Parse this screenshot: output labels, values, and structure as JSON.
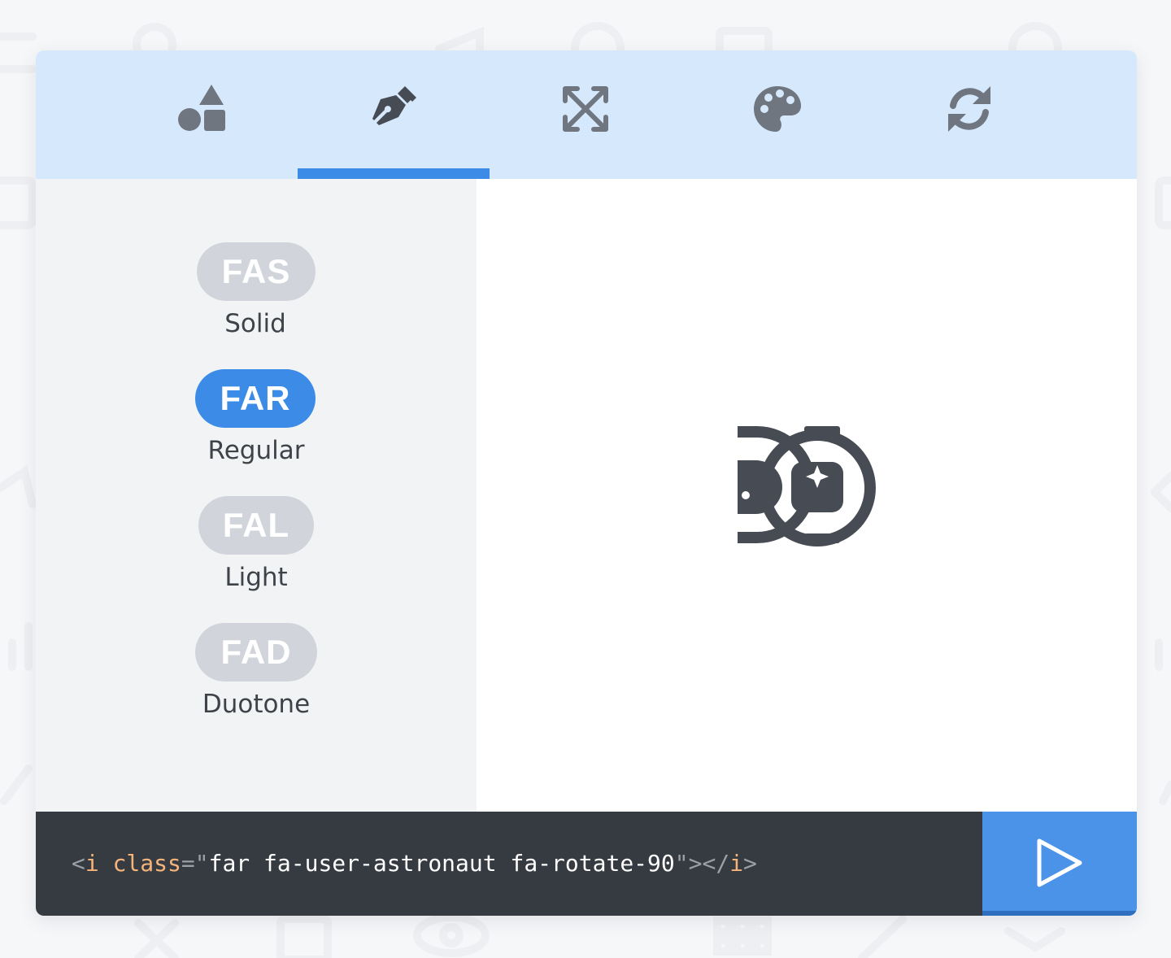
{
  "tabs": [
    {
      "id": "shapes",
      "icon": "shapes-icon",
      "active": false
    },
    {
      "id": "styles",
      "icon": "pen-fancy-icon",
      "active": true
    },
    {
      "id": "transform",
      "icon": "expand-arrows-icon",
      "active": false
    },
    {
      "id": "colors",
      "icon": "palette-icon",
      "active": false
    },
    {
      "id": "animate",
      "icon": "sync-icon",
      "active": false
    }
  ],
  "styles": [
    {
      "prefix": "FAS",
      "label": "Solid",
      "active": false
    },
    {
      "prefix": "FAR",
      "label": "Regular",
      "active": true
    },
    {
      "prefix": "FAL",
      "label": "Light",
      "active": false
    },
    {
      "prefix": "FAD",
      "label": "Duotone",
      "active": false
    }
  ],
  "preview": {
    "icon": "user-astronaut-icon",
    "rotation_degrees": 90
  },
  "code": {
    "open_bracket": "<",
    "tag": "i",
    "attr": "class",
    "equals": "=",
    "quote_open": "\"",
    "value": "far fa-user-astronaut fa-rotate-90",
    "quote_close": "\"",
    "close": "></",
    "end_tag": "i",
    "end_bracket": ">"
  },
  "play_button": {
    "icon": "play-icon"
  },
  "colors": {
    "tabbar_bg": "#d6e9fc",
    "accent": "#3c8ce7",
    "pill_inactive": "#d1d5db",
    "icon_gray": "#6f7680",
    "icon_dark": "#474c54",
    "code_bg": "#363a41",
    "code_attr": "#f5b57a"
  }
}
